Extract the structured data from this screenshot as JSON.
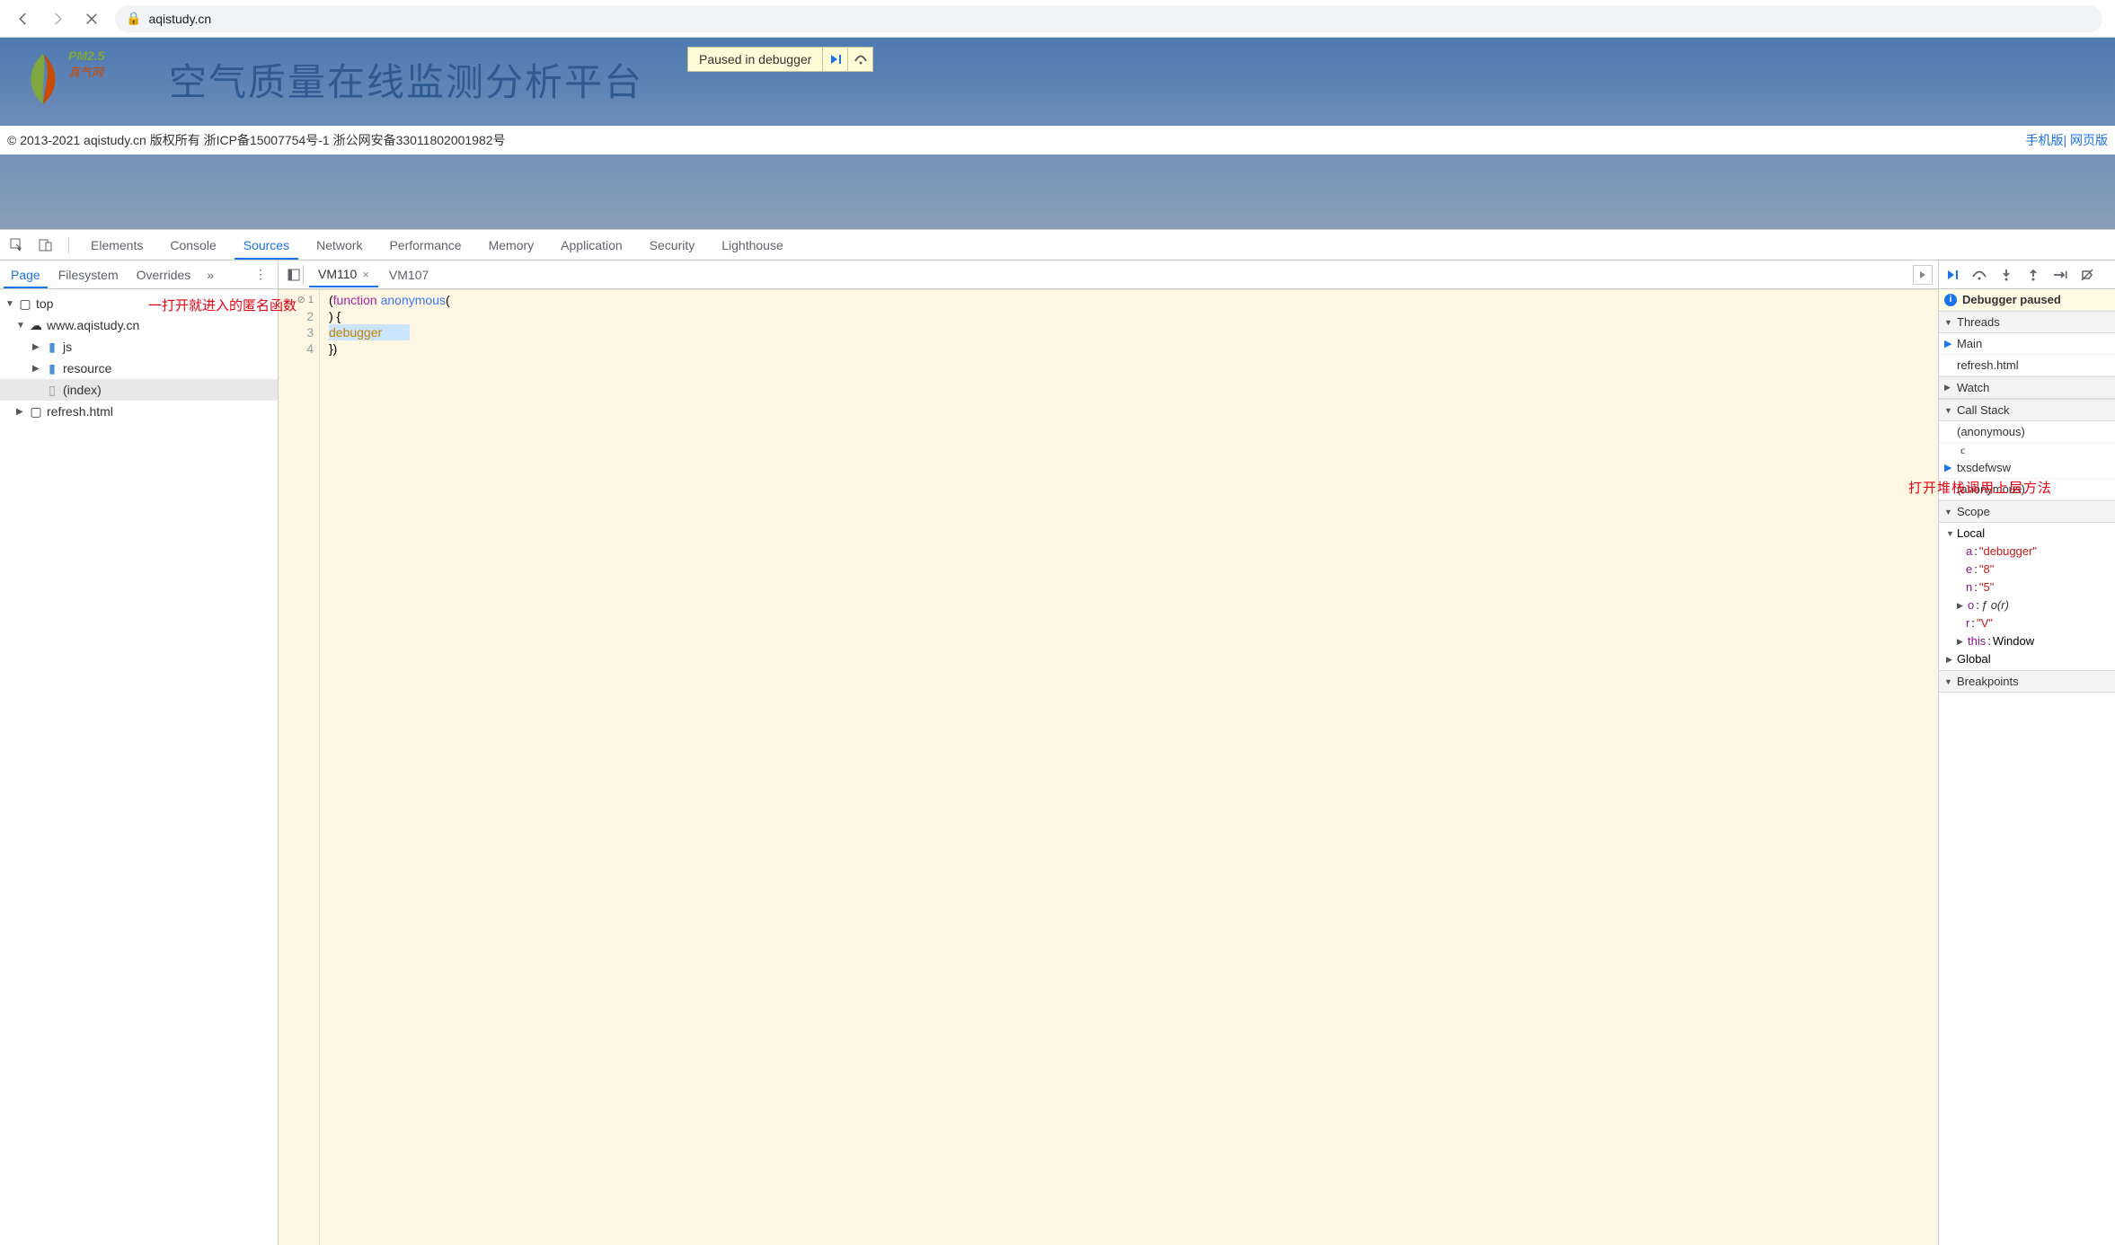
{
  "browser": {
    "url": "aqistudy.cn"
  },
  "page": {
    "logo_pm": "PM2.5",
    "logo_cn": "真气网",
    "title": "空气质量在线监测分析平台",
    "paused_label": "Paused in debugger",
    "copyright": "© 2013-2021 aqistudy.cn 版权所有 浙ICP备15007754号-1 浙公网安备33011802001982号",
    "link_mobile": "手机版",
    "link_web": "网页版"
  },
  "devtools_tabs": [
    "Elements",
    "Console",
    "Sources",
    "Network",
    "Performance",
    "Memory",
    "Application",
    "Security",
    "Lighthouse"
  ],
  "devtools_active_tab": "Sources",
  "subtabs": {
    "items": [
      "Page",
      "Filesystem",
      "Overrides"
    ],
    "active": "Page",
    "more": "»",
    "dots": "⋮"
  },
  "file_tree": {
    "root": "top",
    "site": "www.aqistudy.cn",
    "folders": [
      "js",
      "resource"
    ],
    "file_index": "(index)",
    "other_frame": "refresh.html"
  },
  "editor_tabs": {
    "items": [
      "VM110",
      "VM107"
    ],
    "active": "VM110"
  },
  "code_lines": {
    "1a": "(",
    "1b": "function",
    "1c": " anonymous",
    "1d": "(",
    "2": ") {",
    "3": "debugger",
    "4": "})"
  },
  "debugger": {
    "status": "Debugger paused",
    "threads_label": "Threads",
    "threads": [
      "Main",
      "refresh.html"
    ],
    "watch_label": "Watch",
    "callstack_label": "Call Stack",
    "callstack": [
      "(anonymous)",
      "txsdefwsw",
      "(anonymous)"
    ],
    "callstack_letter": "c",
    "scope_label": "Scope",
    "scope_local": "Local",
    "scope_vars": [
      {
        "k": "a",
        "v": "\"debugger\""
      },
      {
        "k": "e",
        "v": "\"8\""
      },
      {
        "k": "n",
        "v": "\"5\""
      },
      {
        "k": "o",
        "v": "ƒ o(r)",
        "arrow": true,
        "obj": true
      },
      {
        "k": "r",
        "v": "\"V\""
      },
      {
        "k": "this",
        "v": "Window",
        "arrow": true,
        "obj": true
      }
    ],
    "scope_global": "Global",
    "breakpoints_label": "Breakpoints"
  },
  "annotations": {
    "left": "一打开就进入的匿名函数",
    "right": "打开堆栈调用上层方法"
  }
}
